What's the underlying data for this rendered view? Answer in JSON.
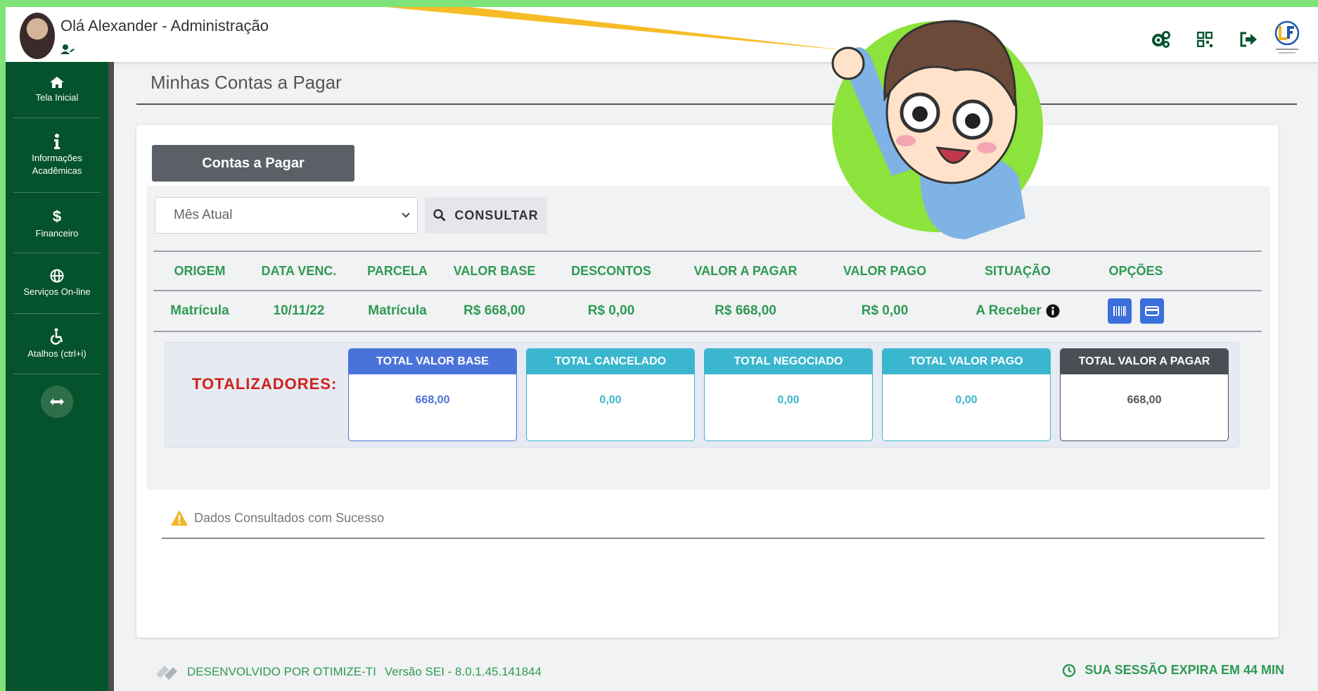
{
  "header": {
    "greeting": "Olá Alexander - Administração",
    "icons": [
      "settings-icon",
      "qrcode-icon",
      "logout-icon",
      "institution-logo"
    ]
  },
  "sidebar": {
    "items": [
      {
        "label": "Tela Inicial",
        "icon": "home-icon"
      },
      {
        "label": "Informações Acadêmicas",
        "icon": "info-icon"
      },
      {
        "label": "Financeiro",
        "icon": "dollar-icon"
      },
      {
        "label": "Serviços On-line",
        "icon": "globe-icon"
      },
      {
        "label": "Atalhos (ctrl+i)",
        "icon": "accessibility-icon"
      }
    ],
    "toggle_icon": "expand-arrows-icon"
  },
  "main": {
    "page_title": "Minhas Contas a Pagar",
    "tab_label": "Contas a Pagar",
    "period_select": {
      "value": "Mês Atual"
    },
    "consult_button": "CONSULTAR",
    "table": {
      "headers": [
        "ORIGEM",
        "DATA VENC.",
        "PARCELA",
        "VALOR BASE",
        "DESCONTOS",
        "VALOR A PAGAR",
        "VALOR PAGO",
        "SITUAÇÃO",
        "OPÇÕES"
      ],
      "rows": [
        {
          "origem": "Matrícula",
          "data_venc": "10/11/22",
          "parcela": "Matrícula",
          "valor_base": "R$ 668,00",
          "descontos": "R$ 0,00",
          "valor_a_pagar": "R$ 668,00",
          "valor_pago": "R$ 0,00",
          "situacao": "A Receber"
        }
      ]
    },
    "totals": {
      "label": "TOTALIZADORES:",
      "boxes": [
        {
          "title": "TOTAL VALOR BASE",
          "value": "668,00",
          "color": "#4a73d9"
        },
        {
          "title": "TOTAL CANCELADO",
          "value": "0,00",
          "color": "#3bb6cf"
        },
        {
          "title": "TOTAL NEGOCIADO",
          "value": "0,00",
          "color": "#3bb6cf"
        },
        {
          "title": "TOTAL VALOR PAGO",
          "value": "0,00",
          "color": "#3bb6cf"
        },
        {
          "title": "TOTAL VALOR A PAGAR",
          "value": "668,00",
          "color": "#4a4e55"
        }
      ]
    },
    "status_message": "Dados Consultados com Sucesso"
  },
  "footer": {
    "developer": "DESENVOLVIDO POR OTIMIZE-TI",
    "version": "Versão SEI - 8.0.1.45.141844",
    "session": "SUA SESSÃO EXPIRA EM 44 MIN"
  },
  "colors": {
    "brand_green": "#05532c",
    "text_green": "#2e9a52",
    "alert_red": "#d0201b"
  }
}
